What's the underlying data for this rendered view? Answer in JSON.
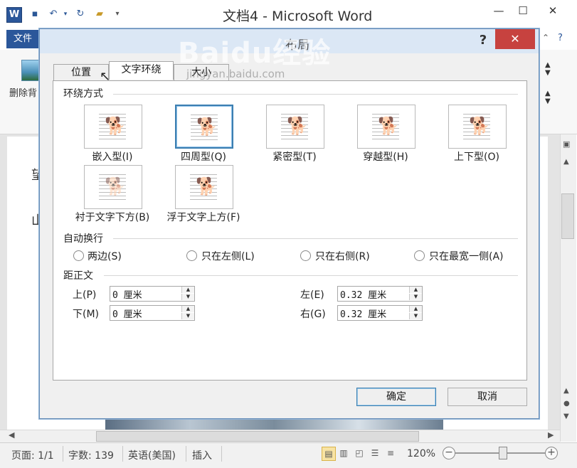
{
  "window": {
    "title": "文档4 - Microsoft Word",
    "file_tab": "文件",
    "remove_background": "删除背",
    "minimize": "—",
    "maximize": "☐",
    "close": "✕"
  },
  "dialog": {
    "title": "布局",
    "help": "?",
    "close": "✕",
    "tabs": [
      "位置",
      "文字环绕",
      "大小"
    ],
    "active_tab": "文字环绕",
    "wrap_section": "环绕方式",
    "wrap_styles": [
      {
        "label": "嵌入型(I)",
        "selected": false
      },
      {
        "label": "四周型(Q)",
        "selected": true
      },
      {
        "label": "紧密型(T)",
        "selected": false
      },
      {
        "label": "穿越型(H)",
        "selected": false
      },
      {
        "label": "上下型(O)",
        "selected": false
      },
      {
        "label": "衬于文字下方(B)",
        "selected": false
      },
      {
        "label": "浮于文字上方(F)",
        "selected": false
      }
    ],
    "wrap_text_section": "自动换行",
    "wrap_text_options": [
      "两边(S)",
      "只在左侧(L)",
      "只在右侧(R)",
      "只在最宽一侧(A)"
    ],
    "distance_section": "距正文",
    "distance": {
      "top_label": "上(P)",
      "top_value": "0 厘米",
      "bottom_label": "下(M)",
      "bottom_value": "0 厘米",
      "left_label": "左(E)",
      "left_value": "0.32 厘米",
      "right_label": "右(G)",
      "right_value": "0.32 厘米"
    },
    "ok": "确定",
    "cancel": "取消"
  },
  "watermark": {
    "text": "Baidu经验",
    "url": "jingyan.baidu.com"
  },
  "statusbar": {
    "page": "页面: 1/1",
    "words": "字数: 139",
    "language": "英语(美国)",
    "mode": "插入",
    "zoom": "120%",
    "zoom_minus": "−",
    "zoom_plus": "+"
  },
  "document": {
    "text1": "望",
    "text2": "山"
  },
  "colors": {
    "word_blue": "#2b579a",
    "close_red": "#c7423f",
    "selection_blue": "#3c7fb1"
  }
}
